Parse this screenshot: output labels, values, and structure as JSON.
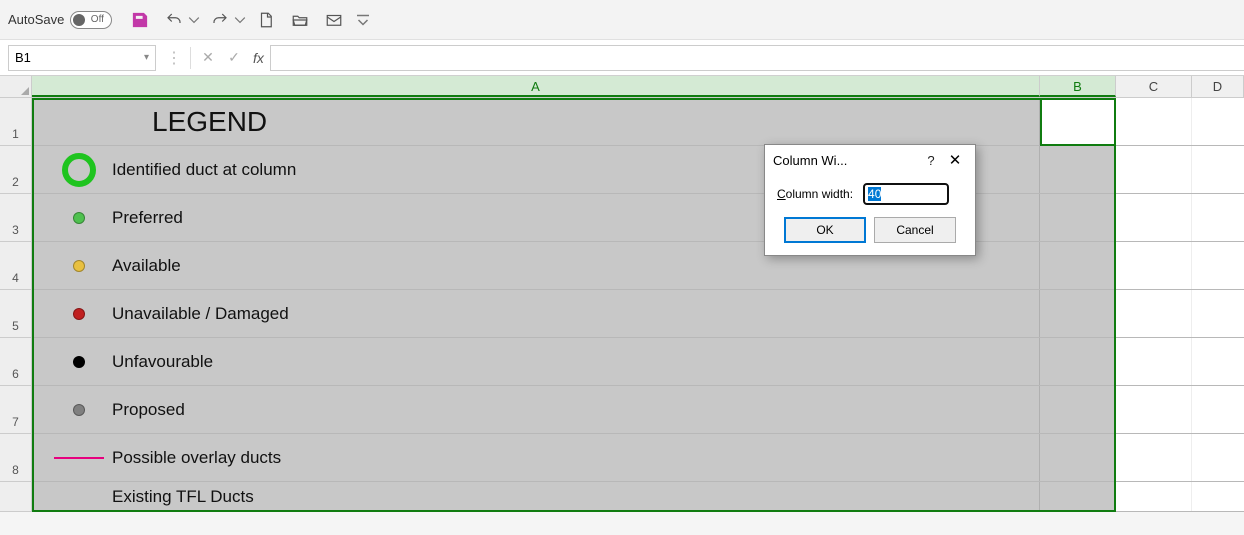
{
  "qat": {
    "autosave_label": "AutoSave",
    "autosave_state": "Off"
  },
  "formula": {
    "name_box": "B1",
    "fx_label": "fx",
    "value": ""
  },
  "columns": [
    "A",
    "B",
    "C",
    "D"
  ],
  "rows": [
    "1",
    "2",
    "3",
    "4",
    "5",
    "6",
    "7",
    "8"
  ],
  "legend": {
    "title": "LEGEND",
    "items": [
      {
        "icon": "ring",
        "label": "Identified duct at column"
      },
      {
        "icon": "dot-green",
        "label": "Preferred"
      },
      {
        "icon": "dot-yellow",
        "label": "Available"
      },
      {
        "icon": "dot-red",
        "label": "Unavailable / Damaged"
      },
      {
        "icon": "dot-black",
        "label": "Unfavourable"
      },
      {
        "icon": "dot-grey",
        "label": "Proposed"
      },
      {
        "icon": "line-magenta",
        "label": "Possible overlay ducts"
      },
      {
        "icon": "",
        "label": "Existing TFL Ducts"
      }
    ]
  },
  "dialog": {
    "title": "Column Wi...",
    "label_pre": "C",
    "label_post": "olumn width:",
    "value": "40",
    "ok": "OK",
    "cancel": "Cancel"
  }
}
